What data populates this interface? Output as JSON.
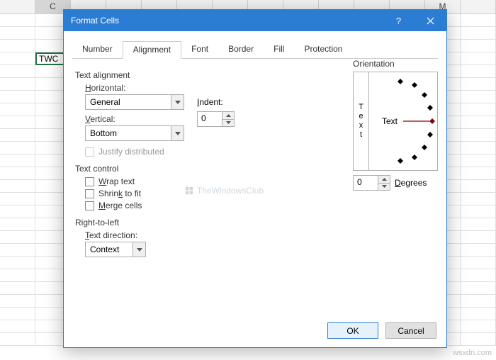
{
  "sheet": {
    "col_visible": "C",
    "col_m": "M",
    "active_cell_value": "TWC"
  },
  "dialog": {
    "title": "Format Cells",
    "tabs": [
      "Number",
      "Alignment",
      "Font",
      "Border",
      "Fill",
      "Protection"
    ],
    "active_tab": "Alignment"
  },
  "alignment": {
    "group_text_alignment": "Text alignment",
    "horizontal_label": "Horizontal:",
    "horizontal_value": "General",
    "vertical_label": "Vertical:",
    "vertical_value": "Bottom",
    "indent_label": "Indent:",
    "indent_value": "0",
    "justify_distributed": "Justify distributed",
    "group_text_control": "Text control",
    "wrap_text": "Wrap text",
    "shrink_to_fit": "Shrink to fit",
    "merge_cells": "Merge cells",
    "group_rtl": "Right-to-left",
    "text_direction_label": "Text direction:",
    "text_direction_value": "Context"
  },
  "orientation": {
    "label": "Orientation",
    "vertical_text": "Text",
    "arc_text": "Text",
    "degrees_value": "0",
    "degrees_label": "Degrees"
  },
  "buttons": {
    "ok": "OK",
    "cancel": "Cancel"
  },
  "watermark": "TheWindowsClub",
  "credit": "wsxdn.com"
}
